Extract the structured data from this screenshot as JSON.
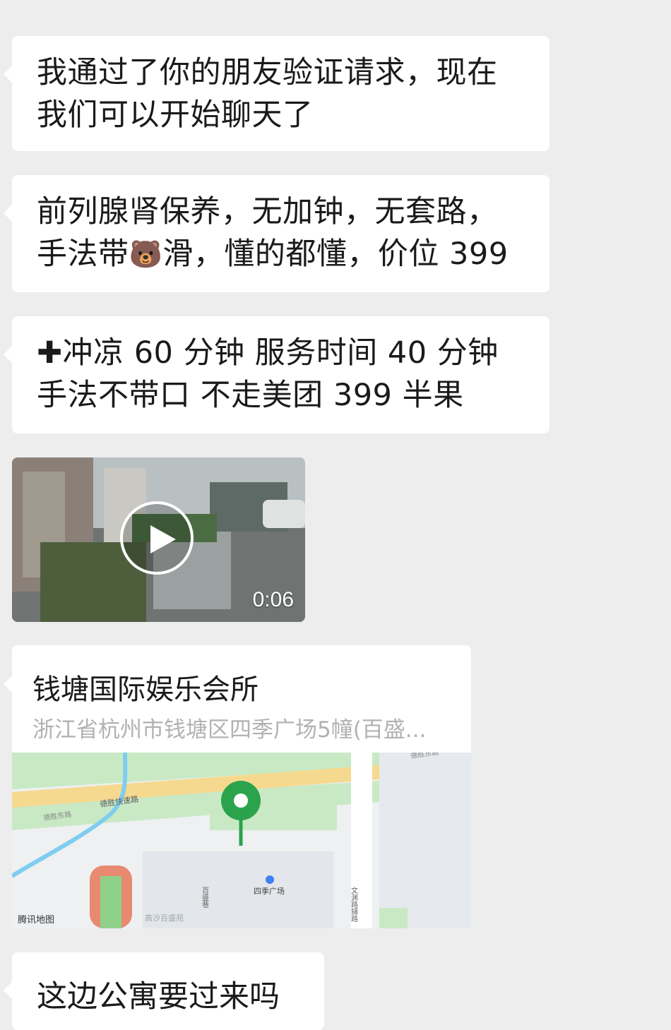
{
  "messages": [
    {
      "lines": [
        "我通过了你的朋友验证请求，现在",
        "我们可以开始聊天了"
      ]
    },
    {
      "line1": "前列腺肾保养，无加钟，无套路，",
      "line2_pre": "手法带",
      "line2_emoji": "🐻",
      "line2_post": "滑，懂的都懂，价位 399"
    },
    {
      "line1_icon": "✚",
      "line1": "冲凉 60 分钟 服务时间 40 分钟",
      "line2": "手法不带口 不走美团 399 半果"
    }
  ],
  "video": {
    "duration": "0:06"
  },
  "location": {
    "name": "钱塘国际娱乐会所",
    "address": "浙江省杭州市钱塘区四季广场5幢(百盛...",
    "map_labels": {
      "road1": "德胜快速路",
      "road2": "德胜东路",
      "road3": "德胜东路",
      "poi1": "四季广场",
      "street1": "百盛巷",
      "street2": "高沙百盛苑",
      "street3": "文渊路辅路",
      "brand": "腾讯地图"
    }
  },
  "last_message": "这边公寓要过来吗"
}
